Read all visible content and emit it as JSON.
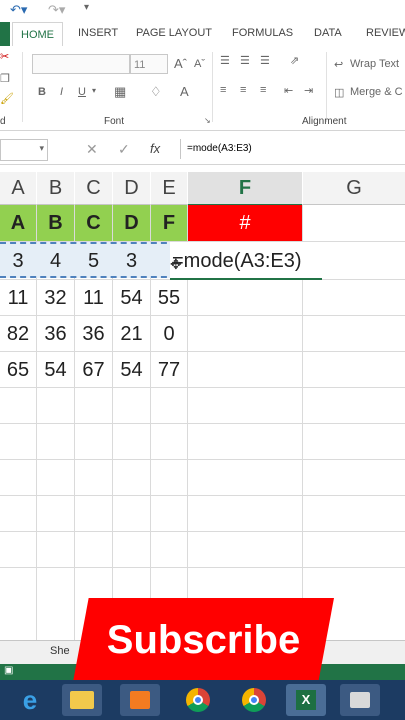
{
  "ribbon": {
    "tabs": [
      "HOME",
      "INSERT",
      "PAGE LAYOUT",
      "FORMULAS",
      "DATA",
      "REVIEW"
    ],
    "active_tab": "HOME",
    "font_size": "11",
    "font_group_label": "Font",
    "alignment_group_label": "Alignment",
    "wrap_text_label": "Wrap Text",
    "merge_label": "Merge & C",
    "clipboard_cut_label": "d"
  },
  "formula_bar": {
    "fx_label": "fx",
    "formula": "=mode(A3:E3)"
  },
  "columns": [
    "A",
    "B",
    "C",
    "D",
    "E",
    "F",
    "G"
  ],
  "header_row": [
    "A",
    "B",
    "C",
    "D",
    "F",
    "#"
  ],
  "rows": [
    [
      "3",
      "4",
      "5",
      "3",
      ""
    ],
    [
      "11",
      "32",
      "11",
      "54",
      "55"
    ],
    [
      "82",
      "36",
      "36",
      "21",
      "0"
    ],
    [
      "65",
      "54",
      "67",
      "54",
      "77"
    ]
  ],
  "editing_cell_text": "=mode(A3:E3)",
  "sheet_tab": "She",
  "overlay": {
    "subscribe_label": "Subscribe"
  },
  "colors": {
    "excel_green": "#217346",
    "header_green": "#92d050",
    "header_red": "#ff0000",
    "subscribe_red": "#ff0000",
    "taskbar": "#1c3b62"
  }
}
